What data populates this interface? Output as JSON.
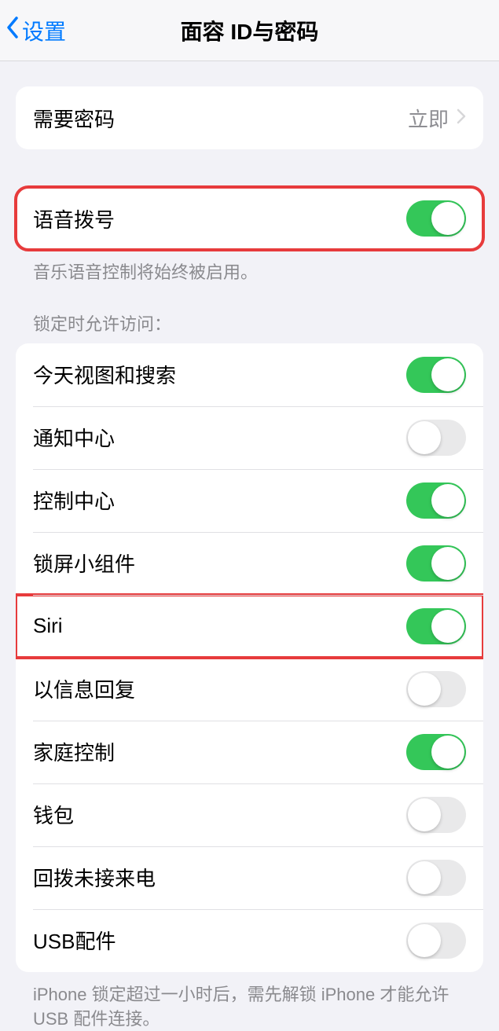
{
  "nav": {
    "back_label": "设置",
    "title": "面容 ID与密码"
  },
  "require_passcode": {
    "label": "需要密码",
    "value": "立即"
  },
  "voice_dial": {
    "label": "语音拨号",
    "on": true,
    "footer": "音乐语音控制将始终被启用。"
  },
  "lock_access": {
    "header": "锁定时允许访问：",
    "items": [
      {
        "label": "今天视图和搜索",
        "on": true
      },
      {
        "label": "通知中心",
        "on": false
      },
      {
        "label": "控制中心",
        "on": true
      },
      {
        "label": "锁屏小组件",
        "on": true
      },
      {
        "label": "Siri",
        "on": true
      },
      {
        "label": "以信息回复",
        "on": false
      },
      {
        "label": "家庭控制",
        "on": true
      },
      {
        "label": "钱包",
        "on": false
      },
      {
        "label": "回拨未接来电",
        "on": false
      },
      {
        "label": "USB配件",
        "on": false
      }
    ],
    "footer": "iPhone 锁定超过一小时后，需先解锁 iPhone 才能允许 USB 配件连接。"
  }
}
